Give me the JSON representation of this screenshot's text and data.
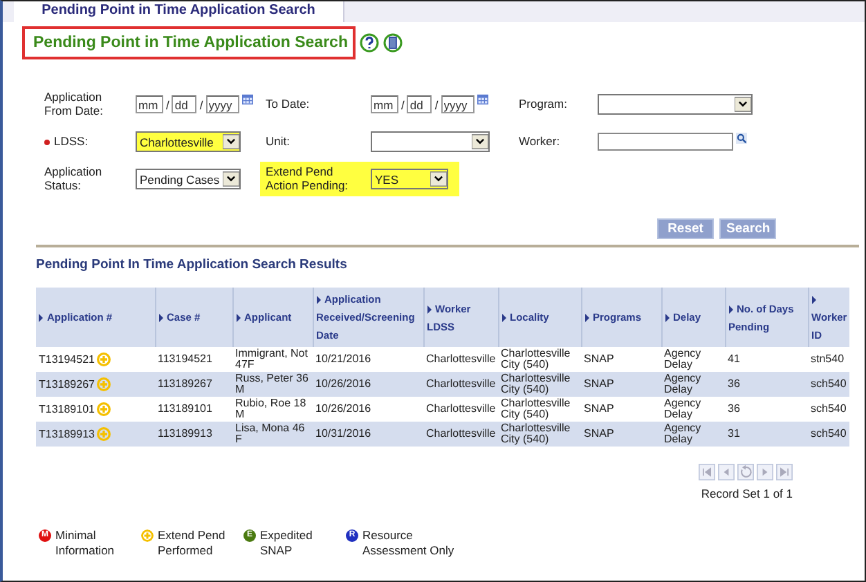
{
  "tab": {
    "label": "Pending Point in Time Application Search",
    "selected": true
  },
  "title": "Pending Point in Time Application Search",
  "form": {
    "rows": [
      [
        {
          "kind": "date",
          "label": "Application From Date:",
          "placeholders": [
            "mm",
            "dd",
            "yyyy"
          ],
          "separator": "/"
        },
        {
          "kind": "date",
          "label": "To Date:",
          "placeholders": [
            "mm",
            "dd",
            "yyyy"
          ],
          "separator": "/"
        },
        {
          "kind": "select",
          "label": "Program:"
        }
      ],
      [
        {
          "kind": "select",
          "label": "LDSS:",
          "required": true,
          "highlighted": true,
          "value": "Charlottesville"
        },
        {
          "kind": "select",
          "label": "Unit:"
        },
        {
          "kind": "lookup",
          "label": "Worker:"
        }
      ],
      [
        {
          "kind": "select",
          "label": "Application Status:",
          "value": "Pending Cases"
        },
        {
          "kind": "select",
          "label": "Extend Pend Action Pending:",
          "highlighted": true,
          "area_highlighted": true,
          "value": "YES"
        }
      ]
    ]
  },
  "buttons": [
    "Reset",
    "Search"
  ],
  "results": {
    "title": "Pending Point In Time Application Search Results",
    "columns": [
      "Application #",
      "Case #",
      "Applicant",
      "Application Received/Screening Date",
      "Worker LDSS",
      "Locality",
      "Programs",
      "Delay",
      "No. of Days Pending",
      "Worker ID"
    ],
    "rows": [
      {
        "extend_pend": true,
        "cells": [
          "T13194521",
          "113194521",
          "Immigrant, Not 47F",
          "10/21/2016",
          "Charlottesville",
          "Charlottesville City (540)",
          "SNAP",
          "Agency Delay",
          "41",
          "stn540"
        ]
      },
      {
        "extend_pend": true,
        "cells": [
          "T13189267",
          "113189267",
          "Russ, Peter 36 M",
          "10/26/2016",
          "Charlottesville",
          "Charlottesville City (540)",
          "SNAP",
          "Agency Delay",
          "36",
          "sch540"
        ]
      },
      {
        "extend_pend": true,
        "cells": [
          "T13189101",
          "113189101",
          "Rubio, Roe 18 M",
          "10/26/2016",
          "Charlottesville",
          "Charlottesville City (540)",
          "SNAP",
          "Agency Delay",
          "36",
          "sch540"
        ]
      },
      {
        "extend_pend": true,
        "cells": [
          "T13189913",
          "113189913",
          "Lisa, Mona 46 F",
          "10/31/2016",
          "Charlottesville",
          "Charlottesville City (540)",
          "SNAP",
          "Agency Delay",
          "31",
          "sch540"
        ]
      }
    ]
  },
  "pager": {
    "record_text": "Record Set 1 of 1"
  },
  "legend": [
    {
      "kind": "letter",
      "letter": "M",
      "color": "#e01010",
      "label": "Minimal Information"
    },
    {
      "kind": "plus",
      "color": "#f5c000",
      "label": "Extend Pend Performed"
    },
    {
      "kind": "letter",
      "letter": "E",
      "color": "#4a7a10",
      "label": "Expedited SNAP"
    },
    {
      "kind": "letter",
      "letter": "R",
      "color": "#2030c0",
      "label": "Resource Assessment Only"
    }
  ]
}
